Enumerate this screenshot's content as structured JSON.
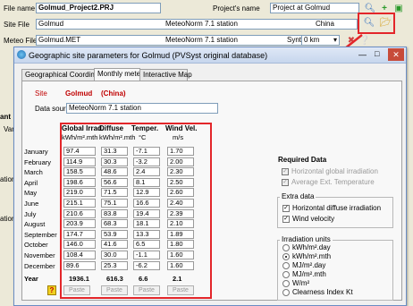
{
  "top": {
    "file_name_label": "File name",
    "file_name_value": "Golmud_Project2.PRJ",
    "project_name_label": "Project's name",
    "project_name_value": "Project at Golmud",
    "site_file_label": "Site File",
    "site_file_value": "Golmud",
    "site_source": "MeteoNorm 7.1 station",
    "site_country": "China",
    "meteo_file_label": "Meteo File",
    "meteo_file_value": "Golmud.MET",
    "meteo_source": "MeteoNorm 7.1 station",
    "meteo_type": "Synthetic",
    "meteo_distance": "0 km"
  },
  "left_partial": {
    "a": "ant",
    "b": "Var",
    "c": "ation",
    "d": "ation"
  },
  "dialog": {
    "title": "Geographic site parameters for Golmud (PVSyst original database)",
    "tabs": [
      "Geographical Coordinates",
      "Monthly meteo",
      "Interactive Map"
    ],
    "site_label": "Site",
    "site_name": "Golmud",
    "site_country": "(China)",
    "data_source_label": "Data source",
    "data_source_value": "MeteoNorm 7.1 station",
    "columns": [
      {
        "title": "Global Irrad.",
        "unit": "kWh/m².mth"
      },
      {
        "title": "Diffuse",
        "unit": "kWh/m².mth"
      },
      {
        "title": "Temper.",
        "unit": "°C"
      },
      {
        "title": "Wind Vel.",
        "unit": "m/s"
      }
    ],
    "months": [
      "January",
      "February",
      "March",
      "April",
      "May",
      "June",
      "July",
      "August",
      "September",
      "October",
      "November",
      "December"
    ],
    "rows": [
      [
        "97.4",
        "31.3",
        "-7.1",
        "1.70"
      ],
      [
        "114.9",
        "30.3",
        "-3.2",
        "2.00"
      ],
      [
        "158.5",
        "48.6",
        "2.4",
        "2.30"
      ],
      [
        "198.6",
        "56.6",
        "8.1",
        "2.50"
      ],
      [
        "219.0",
        "71.5",
        "12.9",
        "2.60"
      ],
      [
        "215.1",
        "75.1",
        "16.6",
        "2.40"
      ],
      [
        "210.6",
        "83.8",
        "19.4",
        "2.39"
      ],
      [
        "203.9",
        "68.3",
        "18.1",
        "2.10"
      ],
      [
        "174.7",
        "53.9",
        "13.3",
        "1.89"
      ],
      [
        "146.0",
        "41.6",
        "6.5",
        "1.80"
      ],
      [
        "108.4",
        "30.0",
        "-1.1",
        "1.60"
      ],
      [
        "89.6",
        "25.3",
        "-6.2",
        "1.60"
      ]
    ],
    "year_label": "Year",
    "year_values": [
      "1936.1",
      "616.3",
      "6.6",
      "2.1"
    ],
    "paste_label": "Paste",
    "help_glyph": "?",
    "required_title": "Required Data",
    "required_items": [
      "Horizontal global irradiation",
      "Average Ext. Temperature"
    ],
    "extra_title": "Extra data",
    "extra_items": [
      "Horizontal diffuse irradiation",
      "Wind velocity"
    ],
    "units_title": "Irradiation units",
    "units_items": [
      "kWh/m².day",
      "kWh/m².mth",
      "MJ/m².day",
      "MJ/m².mth",
      "W/m²",
      "Clearness Index Kt"
    ],
    "units_selected": 1
  },
  "colors": {
    "highlight_red": "#e3262a",
    "site_red": "#c00000"
  }
}
